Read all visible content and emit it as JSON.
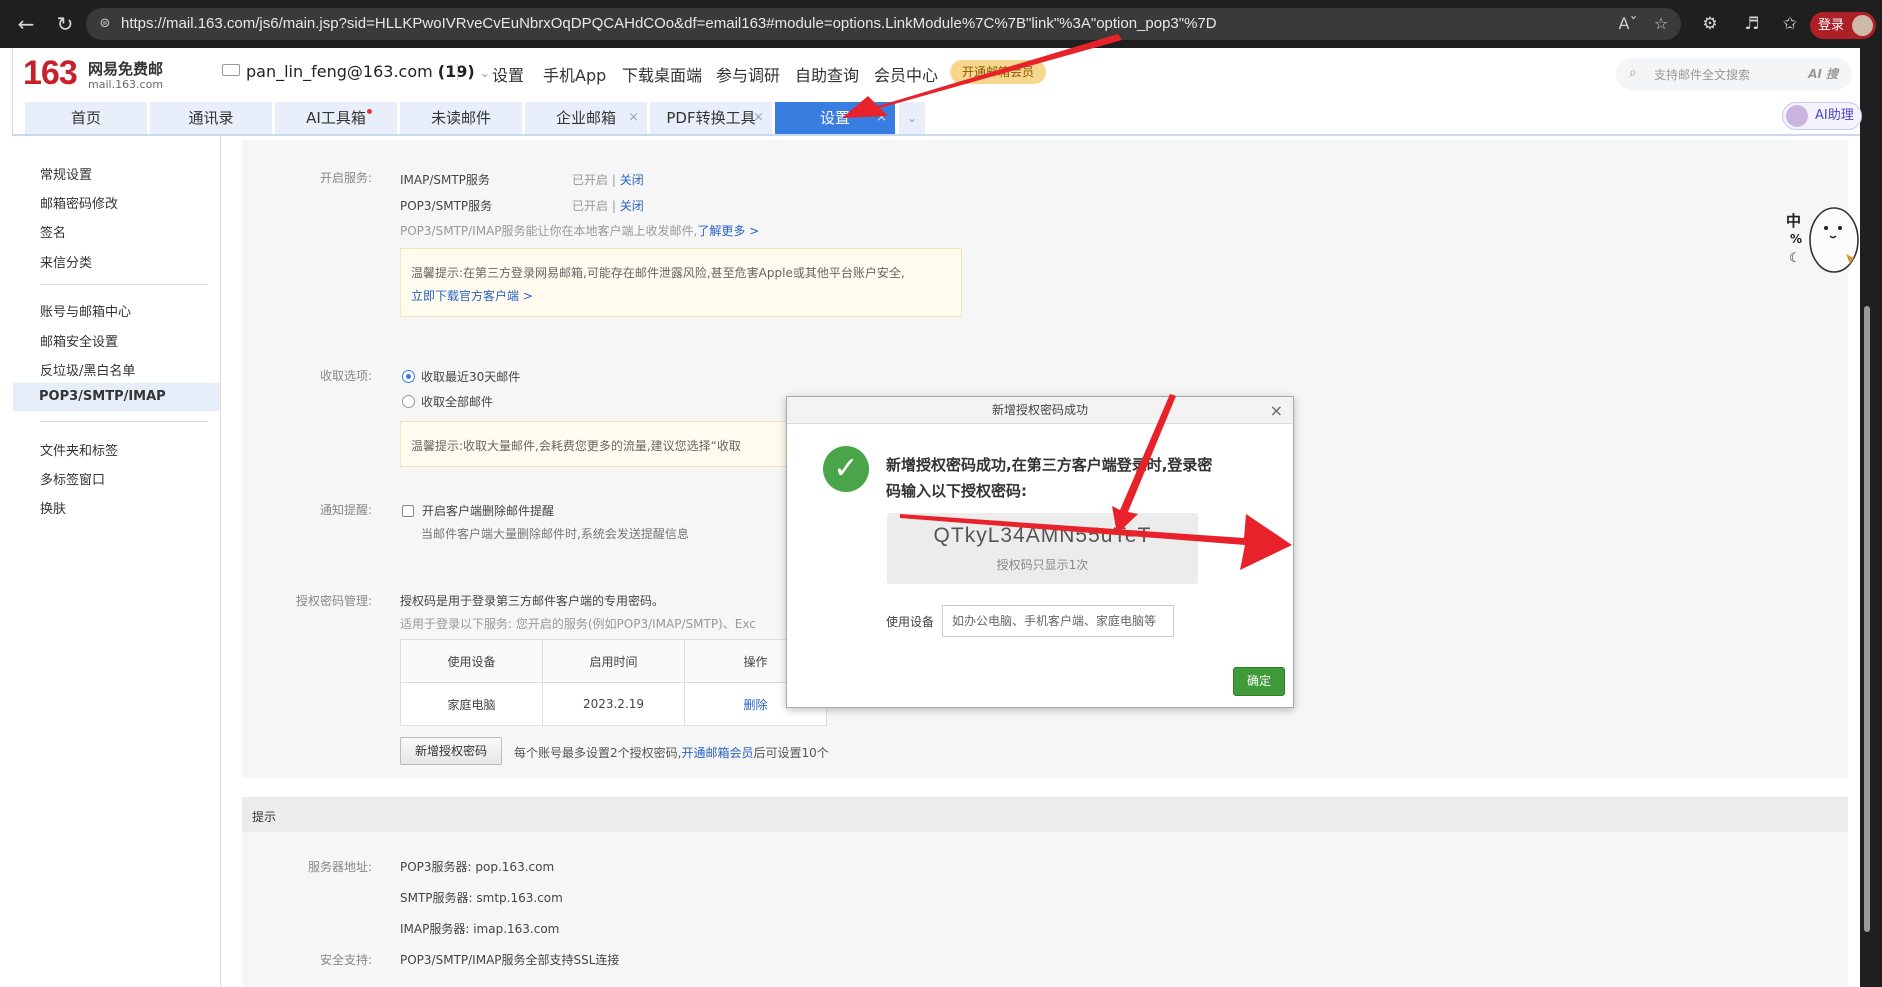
{
  "browser": {
    "url": "https://mail.163.com/js6/main.jsp?sid=HLLKPwoIVRveCvEuNbrxOqDPQCAHdCOo&df=email163#module=options.LinkModule%7C%7B\"link\"%3A\"option_pop3\"%7D",
    "login_label": "登录"
  },
  "header": {
    "logo_number": "163",
    "logo_name": "网易免费邮",
    "logo_domain": "mail.163.com",
    "account": "pan_lin_feng@163.com",
    "unread_count": "(19)",
    "links": [
      "设置",
      "手机App",
      "下载桌面端",
      "参与调研",
      "自助查询",
      "会员中心"
    ],
    "vip_badge": "开通邮箱会员",
    "search_placeholder": "支持邮件全文搜索",
    "search_ai": "AI 搜"
  },
  "tabs": [
    {
      "label": "首页"
    },
    {
      "label": "通讯录"
    },
    {
      "label": "AI工具箱"
    },
    {
      "label": "未读邮件"
    },
    {
      "label": "企业邮箱"
    },
    {
      "label": "PDF转换工具"
    },
    {
      "label": "设置"
    }
  ],
  "ai_assistant": "AI助理",
  "sidebar": {
    "group1": [
      "常规设置",
      "邮箱密码修改",
      "签名",
      "来信分类"
    ],
    "group2": [
      "账号与邮箱中心",
      "邮箱安全设置",
      "反垃圾/黑白名单",
      "POP3/SMTP/IMAP"
    ],
    "group3": [
      "文件夹和标签",
      "多标签窗口",
      "换肤"
    ]
  },
  "services": {
    "label": "开启服务:",
    "rows": [
      {
        "name": "IMAP/SMTP服务",
        "status": "已开启",
        "action": "关闭"
      },
      {
        "name": "POP3/SMTP服务",
        "status": "已开启",
        "action": "关闭"
      }
    ],
    "desc": "POP3/SMTP/IMAP服务能让你在本地客户端上收发邮件,",
    "learn_more": "了解更多 >",
    "tip": "温馨提示:在第三方登录网易邮箱,可能存在邮件泄露风险,甚至危害Apple或其他平台账户安全,",
    "tip_link": "立即下载官方客户端 >"
  },
  "receive": {
    "label": "收取选项:",
    "options": [
      "收取最近30天邮件",
      "收取全部邮件"
    ],
    "selected": "收取最近30天邮件",
    "tip": "温馨提示:收取大量邮件,会耗费您更多的流量,建议您选择“收取"
  },
  "notify": {
    "label": "通知提醒:",
    "checkbox": "开启客户端删除邮件提醒",
    "desc": "当邮件客户端大量删除邮件时,系统会发送提醒信息"
  },
  "auth": {
    "label": "授权密码管理:",
    "desc1": "授权码是用于登录第三方邮件客户端的专用密码。",
    "desc2": "适用于登录以下服务: 您开启的服务(例如POP3/IMAP/SMTP)、Exc",
    "table_headers": [
      "使用设备",
      "启用时间",
      "操作"
    ],
    "table_rows": [
      [
        "家庭电脑",
        "2023.2.19",
        "删除"
      ]
    ],
    "add_button": "新增授权密码",
    "limit_text": "每个账号最多设置2个授权密码,",
    "limit_link": "开通邮箱会员",
    "limit_suffix": "后可设置10个"
  },
  "hint": {
    "title": "提示",
    "server_label": "服务器地址:",
    "servers": [
      "POP3服务器: pop.163.com",
      "SMTP服务器: smtp.163.com",
      "IMAP服务器: imap.163.com"
    ],
    "security_label": "安全支持:",
    "security": "POP3/SMTP/IMAP服务全部支持SSL连接"
  },
  "modal": {
    "title": "新增授权密码成功",
    "message": "新增授权密码成功,在第三方客户端登录时,登录密码输入以下授权密码:",
    "code": "QTkyL34AMN55uTeT",
    "code_note": "授权码只显示1次",
    "device_label": "使用设备",
    "device_placeholder": "如办公电脑、手机客户端、家庭电脑等",
    "ok_button": "确定"
  },
  "mascot_text": [
    "中",
    "%",
    "☾"
  ],
  "colors": {
    "accent_blue": "#3a7de0",
    "brand_red": "#c8202b",
    "annotation_red": "#e8222a",
    "success_green": "#4aa54a",
    "ok_button": "#3f9a3a"
  }
}
